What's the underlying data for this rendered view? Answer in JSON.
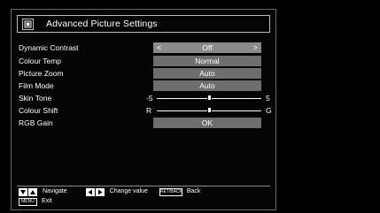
{
  "menu": {
    "title": "Advanced Picture Settings",
    "rows": [
      {
        "label": "Dynamic Contrast",
        "type": "select",
        "value": "Off",
        "selected": true
      },
      {
        "label": "Colour Temp",
        "type": "value",
        "value": "Normal"
      },
      {
        "label": "Picture Zoom",
        "type": "value",
        "value": "Auto"
      },
      {
        "label": "Film Mode",
        "type": "value",
        "value": "Auto"
      },
      {
        "label": "Skin Tone",
        "type": "slider",
        "min_label": "-5",
        "max_label": "5",
        "level": 0.5
      },
      {
        "label": "Colour Shift",
        "type": "slider",
        "min_label": "R",
        "max_label": "G",
        "level": 0.5
      },
      {
        "label": "RGB Gain",
        "type": "value",
        "value": "OK"
      }
    ]
  },
  "footer": {
    "navigate_label": "Navigate",
    "change_value_label": "Change value",
    "ret_back_key": "RET/BACK",
    "back_label": "Back",
    "menu_key": "MENU",
    "exit_label": "Exit"
  },
  "colors": {
    "background": "#000000",
    "value_box": "#6e6e6e",
    "value_box_selected": "#8a8a8a",
    "text": "#ffffff"
  }
}
